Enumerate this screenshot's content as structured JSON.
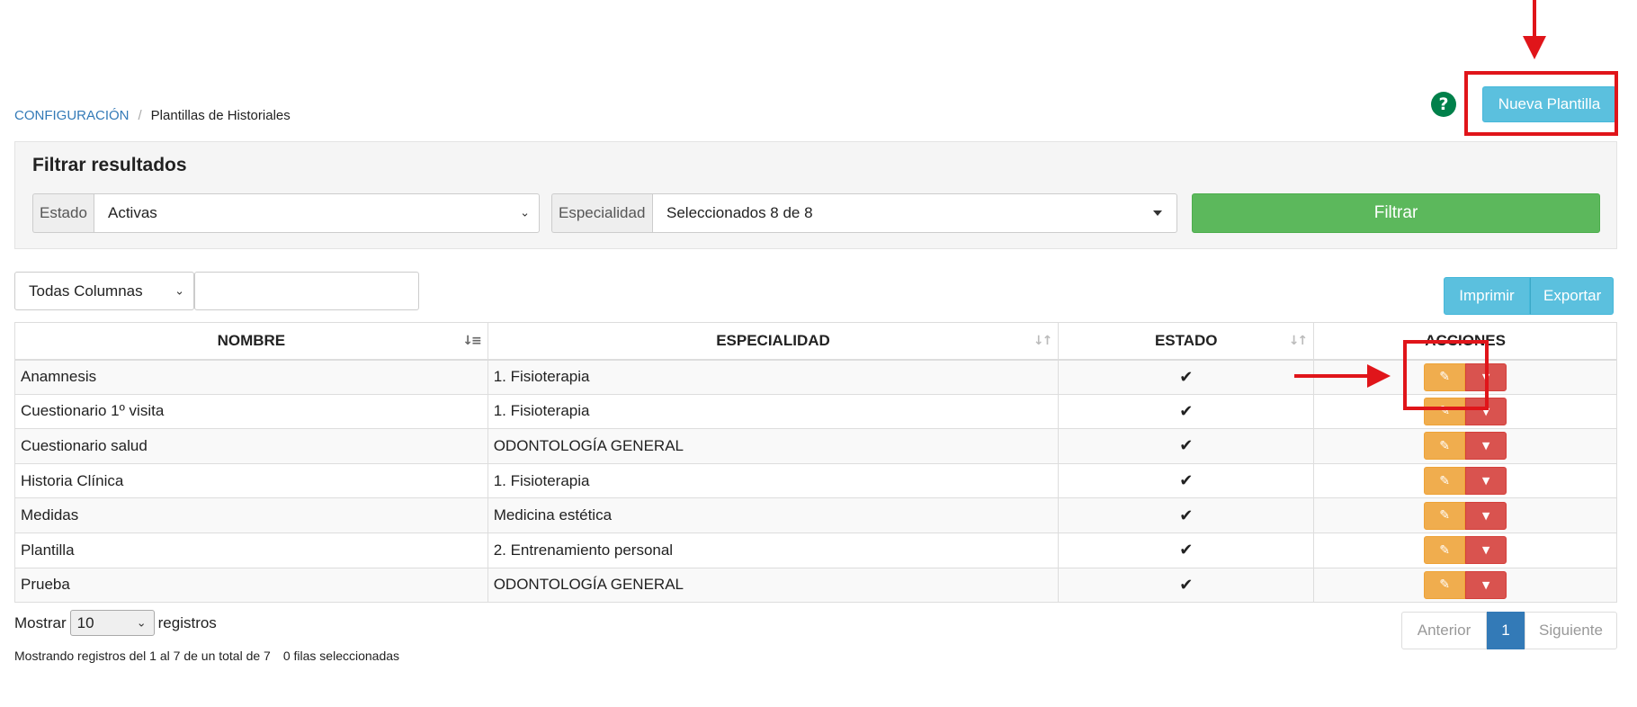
{
  "breadcrumb": {
    "root": "CONFIGURACIÓN",
    "separator": "/",
    "current": "Plantillas de Historiales"
  },
  "header": {
    "help": "?",
    "new_button": "Nueva Plantilla"
  },
  "filter": {
    "title": "Filtrar resultados",
    "estado_label": "Estado",
    "estado_value": "Activas",
    "especialidad_label": "Especialidad",
    "especialidad_value": "Seleccionados 8 de 8",
    "submit": "Filtrar"
  },
  "search": {
    "column_select": "Todas Columnas",
    "value": ""
  },
  "toolbar": {
    "print": "Imprimir",
    "export": "Exportar"
  },
  "table": {
    "headers": [
      "NOMBRE",
      "ESPECIALIDAD",
      "ESTADO",
      "ACCIONES"
    ],
    "rows": [
      {
        "nombre": "Anamnesis",
        "especialidad": "1. Fisioterapia",
        "estado": "✔"
      },
      {
        "nombre": "Cuestionario 1º visita",
        "especialidad": "1. Fisioterapia",
        "estado": "✔"
      },
      {
        "nombre": "Cuestionario salud",
        "especialidad": "ODONTOLOGÍA GENERAL",
        "estado": "✔"
      },
      {
        "nombre": "Historia Clínica",
        "especialidad": "1. Fisioterapia",
        "estado": "✔"
      },
      {
        "nombre": "Medidas",
        "especialidad": "Medicina estética",
        "estado": "✔"
      },
      {
        "nombre": "Plantilla",
        "especialidad": "2. Entrenamiento personal",
        "estado": "✔"
      },
      {
        "nombre": "Prueba",
        "especialidad": "ODONTOLOGÍA GENERAL",
        "estado": "✔"
      }
    ]
  },
  "footer": {
    "show_label": "Mostrar",
    "show_value": "10",
    "records_label": "registros",
    "info": "Mostrando registros del 1 al 7 de un total de 7",
    "selected": "0 filas seleccionadas"
  },
  "pagination": {
    "prev": "Anterior",
    "current": "1",
    "next": "Siguiente"
  },
  "colors": {
    "annotation": "#e0151a",
    "info": "#5bc0de",
    "success": "#5cb85c",
    "warning": "#f0ad4e",
    "danger": "#d9534f",
    "primary": "#337ab7"
  },
  "icons": {
    "edit": "pencil-icon",
    "dropdown": "chevron-down-icon",
    "state": "check-icon"
  }
}
